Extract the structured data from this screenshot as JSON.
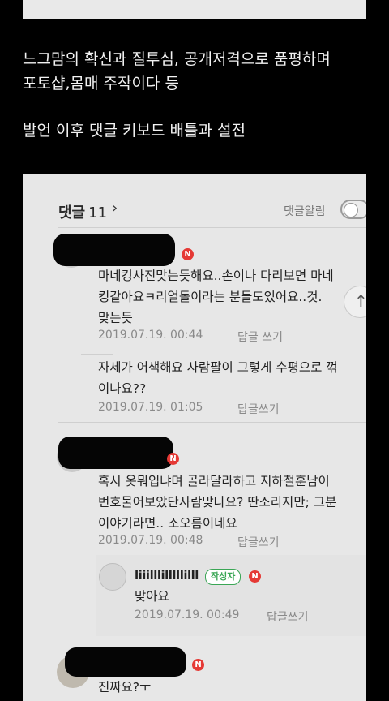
{
  "caption": {
    "line1": "느그맘의 확신과 질투심, 공개저격으로 품평하며",
    "line2": "포토샵,몸매 주작이다 등",
    "line3": "발언 이후 댓글 키보드 배틀과 설전"
  },
  "comments_header": {
    "title": "댓글",
    "count": "11",
    "chevron": "›",
    "notify_label": "댓글알림"
  },
  "comments": [
    {
      "badge": "N",
      "lines": [
        "마네킹사진맞는듯해요..손이나 다리보면 마네",
        "킹같아요ㅋ리얼돌이라는 분들도있어요..것.",
        "맞는듯"
      ],
      "date": "2019.07.19. 00:44",
      "reply": "답글 쓰기"
    },
    {
      "lines": [
        "자세가 어색해요 사람팔이 그렇게 수평으로 꺾",
        "이나요??"
      ],
      "date": "2019.07.19. 01:05",
      "reply": "답글쓰기"
    },
    {
      "badge": "N",
      "lines": [
        "혹시 옷뭐입냐며 골라달라하고 지하철훈남이",
        "번호물어보았단사람맞나요? 딴소리지만; 그분",
        "이야기라면.. 소오름이네요"
      ],
      "date": "2019.07.19. 00:48",
      "reply": "답글쓰기"
    },
    {
      "name": "liiilllilllllilll",
      "author_tag": "작성자",
      "badge": "N",
      "lines": [
        "맞아요"
      ],
      "date": "2019.07.19. 00:49",
      "reply": "답글쓰기"
    },
    {
      "badge": "N",
      "lines": [
        "진짜요?ㅜ"
      ]
    }
  ],
  "icons": {
    "scroll_top": "↑"
  }
}
